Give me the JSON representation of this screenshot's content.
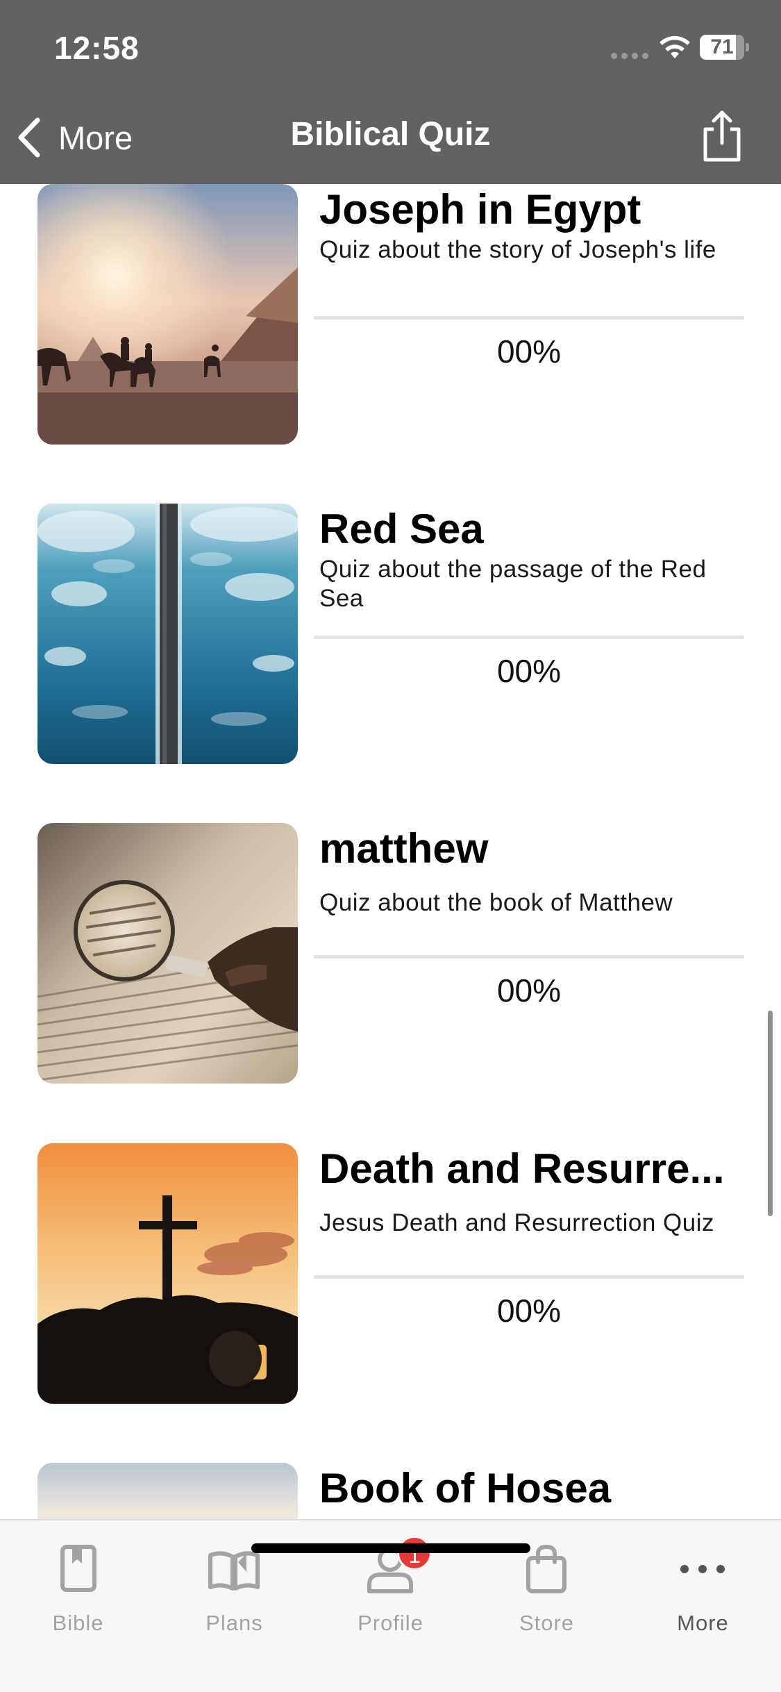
{
  "status_bar": {
    "time": "12:58",
    "battery": "71"
  },
  "header": {
    "back_label": "More",
    "title": "Biblical Quiz"
  },
  "quizzes": [
    {
      "title": "Joseph in Egypt",
      "subtitle": "Quiz about the story of Joseph's life",
      "progress": "00%",
      "image": "desert-pyramids-camels"
    },
    {
      "title": "Red Sea",
      "subtitle": "Quiz about the passage of the Red Sea",
      "progress": "00%",
      "image": "parted-sea-path"
    },
    {
      "title": "matthew",
      "subtitle": "Quiz about the book of Matthew",
      "progress": "00%",
      "image": "magnifying-glass-scroll"
    },
    {
      "title": "Death and Resurre...",
      "subtitle": "Jesus Death and Resurrection Quiz",
      "progress": "00%",
      "image": "cross-on-hill-sunset"
    },
    {
      "title": "Book of Hosea",
      "subtitle": "",
      "progress": "",
      "image": "sky-gradient"
    }
  ],
  "tab_bar": {
    "tabs": [
      {
        "label": "Bible",
        "icon": "book-icon"
      },
      {
        "label": "Plans",
        "icon": "open-book-icon"
      },
      {
        "label": "Profile",
        "icon": "person-icon",
        "badge": "1"
      },
      {
        "label": "Store",
        "icon": "shopping-bag-icon"
      },
      {
        "label": "More",
        "icon": "more-dots-icon",
        "active": true
      }
    ]
  },
  "colors": {
    "header_bg": "#626262",
    "badge": "#e53935",
    "tab_inactive": "#a3a3a3",
    "tab_active": "#555555"
  }
}
